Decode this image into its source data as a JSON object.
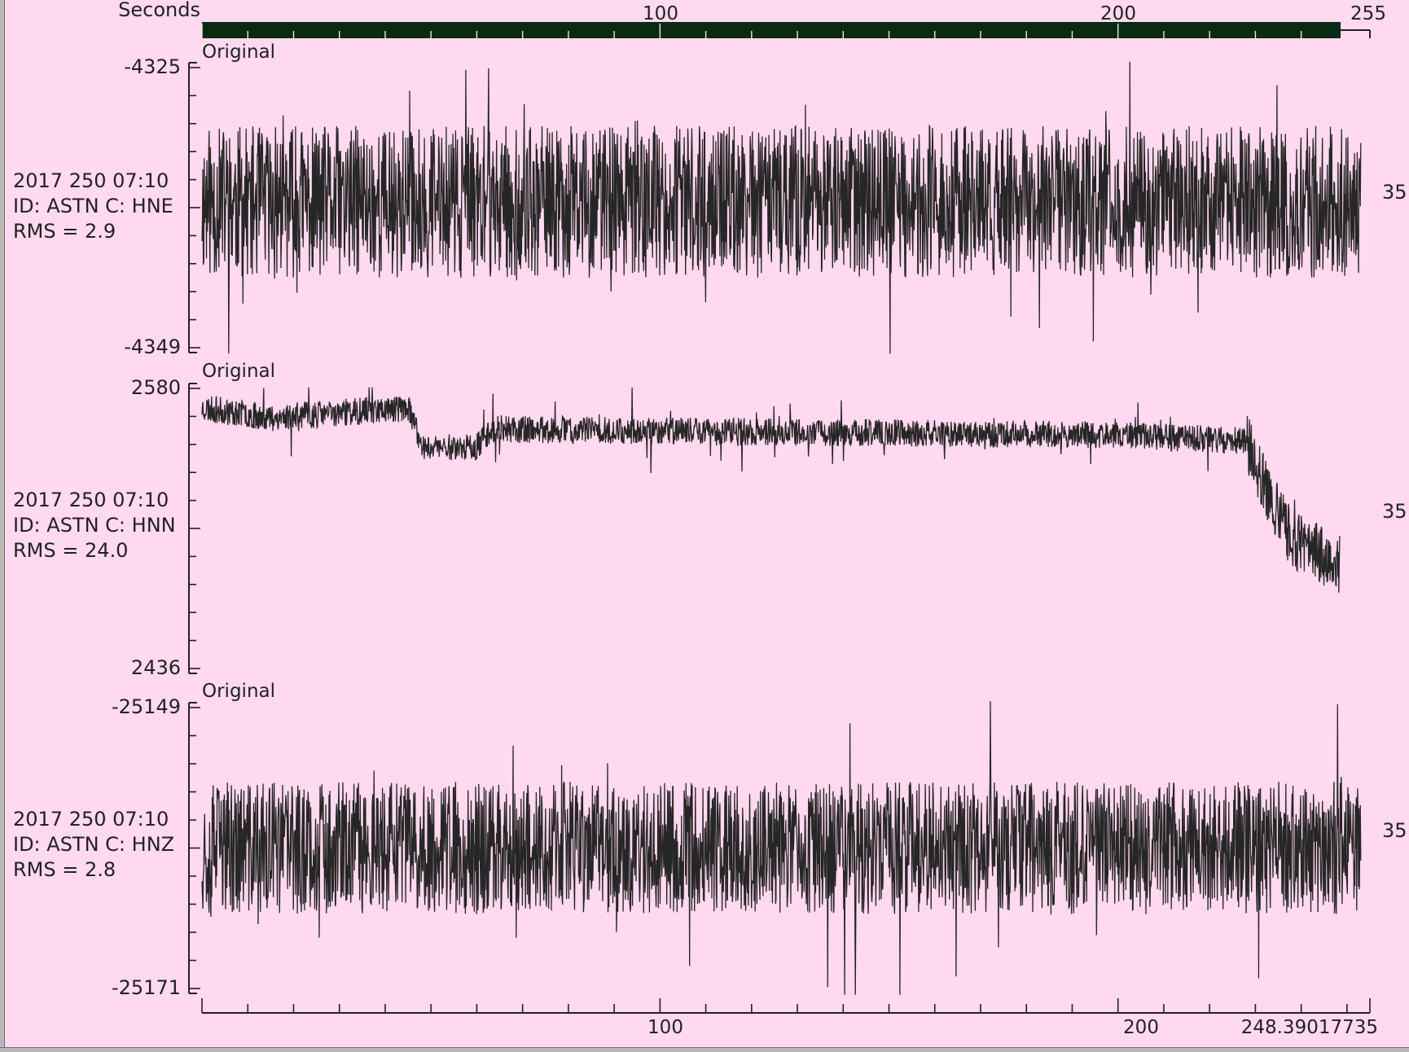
{
  "chart_data": {
    "type": "line",
    "xlabel": "Seconds",
    "xlim": [
      0,
      255
    ],
    "top_axis_ticks": [
      "100",
      "200",
      "255"
    ],
    "bottom_axis_ticks": [
      "100",
      "200",
      "248.39017735"
    ],
    "scroll_bar_range": [
      0,
      248.39
    ],
    "panels": [
      {
        "panel_title": "Original",
        "date": "2017 250 07:10",
        "id_line": "ID: ASTN C: HNE",
        "rms": "RMS = 2.9",
        "right_value": "35",
        "ymax": "-4325",
        "ymin": "-4349",
        "ylim": [
          -4349,
          -4325
        ],
        "baseline": -4336.5,
        "noise_amplitude": 6.5,
        "spike_amplitude": 11,
        "end_time": 253,
        "seed": 11,
        "trend": [
          [
            0,
            0
          ],
          [
            253,
            0
          ]
        ]
      },
      {
        "panel_title": "Original",
        "date": "2017 250 07:10",
        "id_line": "ID: ASTN C: HNN",
        "rms": "RMS = 24.0",
        "right_value": "35",
        "ymax": "2580",
        "ymin": "2436",
        "ylim": [
          2436,
          2580
        ],
        "baseline": 2550,
        "noise_amplitude": 7,
        "spike_amplitude": 18,
        "end_time": 248.4,
        "seed": 23,
        "trend": [
          [
            0,
            20
          ],
          [
            15,
            15
          ],
          [
            45,
            20
          ],
          [
            48,
            0
          ],
          [
            60,
            0
          ],
          [
            63,
            9
          ],
          [
            200,
            6
          ],
          [
            228,
            3
          ],
          [
            232,
            -20
          ],
          [
            238,
            -48
          ],
          [
            248.4,
            -60
          ]
        ]
      },
      {
        "panel_title": "Original",
        "date": "2017 250 07:10",
        "id_line": "ID: ASTN C: HNZ",
        "rms": "RMS = 2.8",
        "right_value": "35",
        "ymax": "-25149",
        "ymin": "-25171",
        "ylim": [
          -25171,
          -25149
        ],
        "baseline": -25160,
        "noise_amplitude": 5.2,
        "spike_amplitude": 9,
        "end_time": 253,
        "seed": 37,
        "trend": [
          [
            0,
            0
          ],
          [
            253,
            0
          ]
        ]
      }
    ]
  }
}
